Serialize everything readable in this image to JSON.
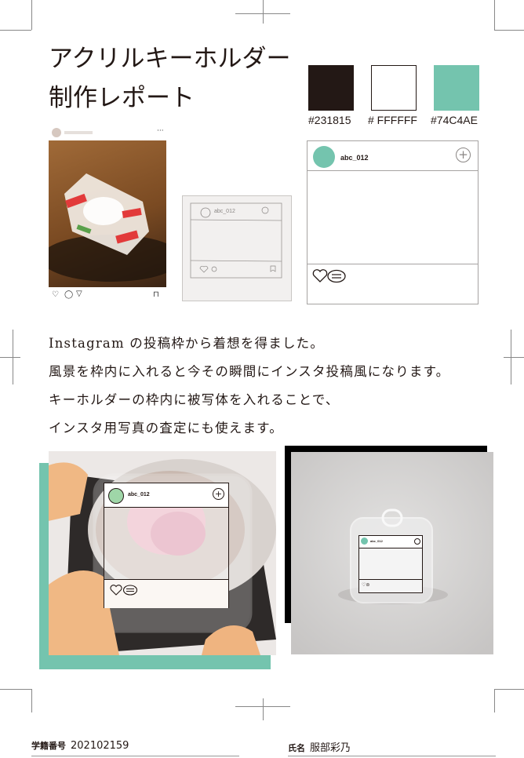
{
  "title": {
    "line1": "アクリルキーホルダー",
    "line2": "制作レポート"
  },
  "palette": [
    {
      "hex": "#231815",
      "label": "#231815"
    },
    {
      "hex": "#FFFFFF",
      "label": "# FFFFFF"
    },
    {
      "hex": "#74C4AE",
      "label": "#74C4AE"
    }
  ],
  "mockup": {
    "username": "abc_012"
  },
  "sketch": {
    "username": "abc_012"
  },
  "body": {
    "lines": [
      "Instagram の投稿枠から着想を得ました。",
      "風景を枠内に入れると今その瞬間にインスタ投稿風になります。",
      "キーホルダーの枠内に被写体を入れることで、",
      "インスタ用写真の査定にも使えます。"
    ]
  },
  "photo1": {
    "username": "abc_012"
  },
  "photo2": {
    "username": "abc_012"
  },
  "footer": {
    "student_id_label": "学籍番号",
    "student_id": "202102159",
    "name_label": "氏名",
    "name": "服部彩乃"
  }
}
